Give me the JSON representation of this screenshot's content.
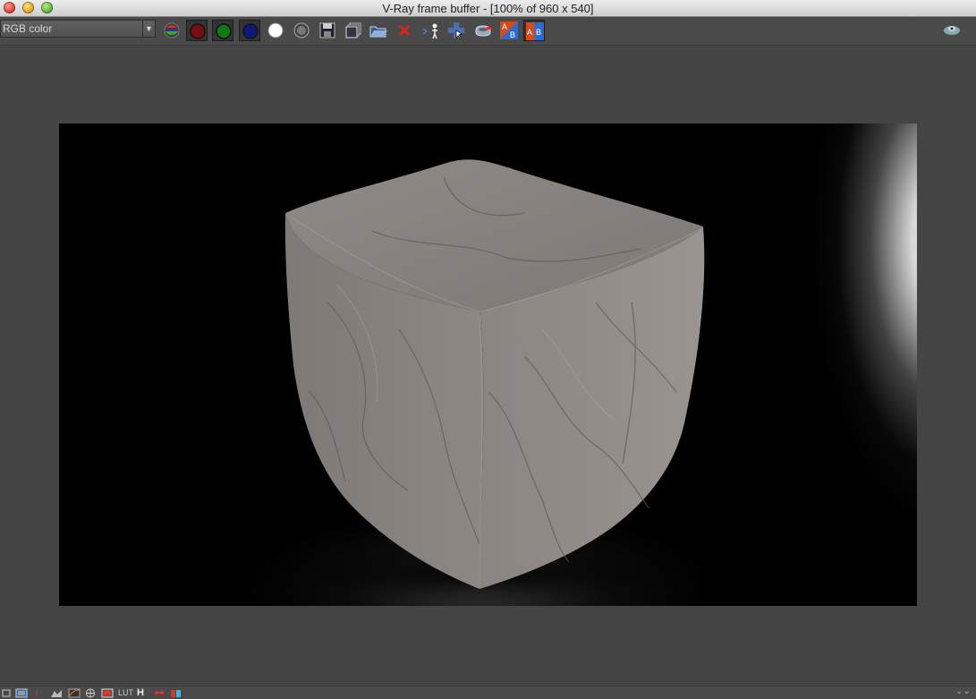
{
  "window": {
    "title": "V-Ray frame buffer - [100% of 960 x 540]"
  },
  "toolbar": {
    "channel_select_value": "RGB color",
    "buttons": [
      {
        "name": "display-rgb-icon"
      },
      {
        "name": "red-channel-icon"
      },
      {
        "name": "green-channel-icon"
      },
      {
        "name": "blue-channel-icon"
      },
      {
        "name": "alpha-channel-icon"
      },
      {
        "name": "monochrome-icon"
      },
      {
        "name": "save-image-icon"
      },
      {
        "name": "save-all-icon"
      },
      {
        "name": "open-image-icon"
      },
      {
        "name": "clear-image-icon"
      },
      {
        "name": "track-mouse-icon"
      },
      {
        "name": "follow-mouse-icon"
      },
      {
        "name": "render-icon"
      },
      {
        "name": "compare-ab-horizontal-icon"
      },
      {
        "name": "compare-ab-vertical-icon"
      }
    ]
  },
  "bottom_bar": {
    "icons": [
      "show-corrections-icon",
      "color-clamp-icon",
      "pixel-info-icon",
      "levels-icon",
      "curve-icon",
      "exposure-icon",
      "srgb-icon",
      "lut-icon",
      "histogram-icon",
      "history-icon",
      "stereo-icon"
    ],
    "labels": {
      "i": "i",
      "lut": "LUT",
      "h": "H"
    }
  },
  "colors": {
    "background": "#444444",
    "toolbar": "#4a4a4a",
    "render_bg": "#000000",
    "stone": "#8f8986"
  }
}
